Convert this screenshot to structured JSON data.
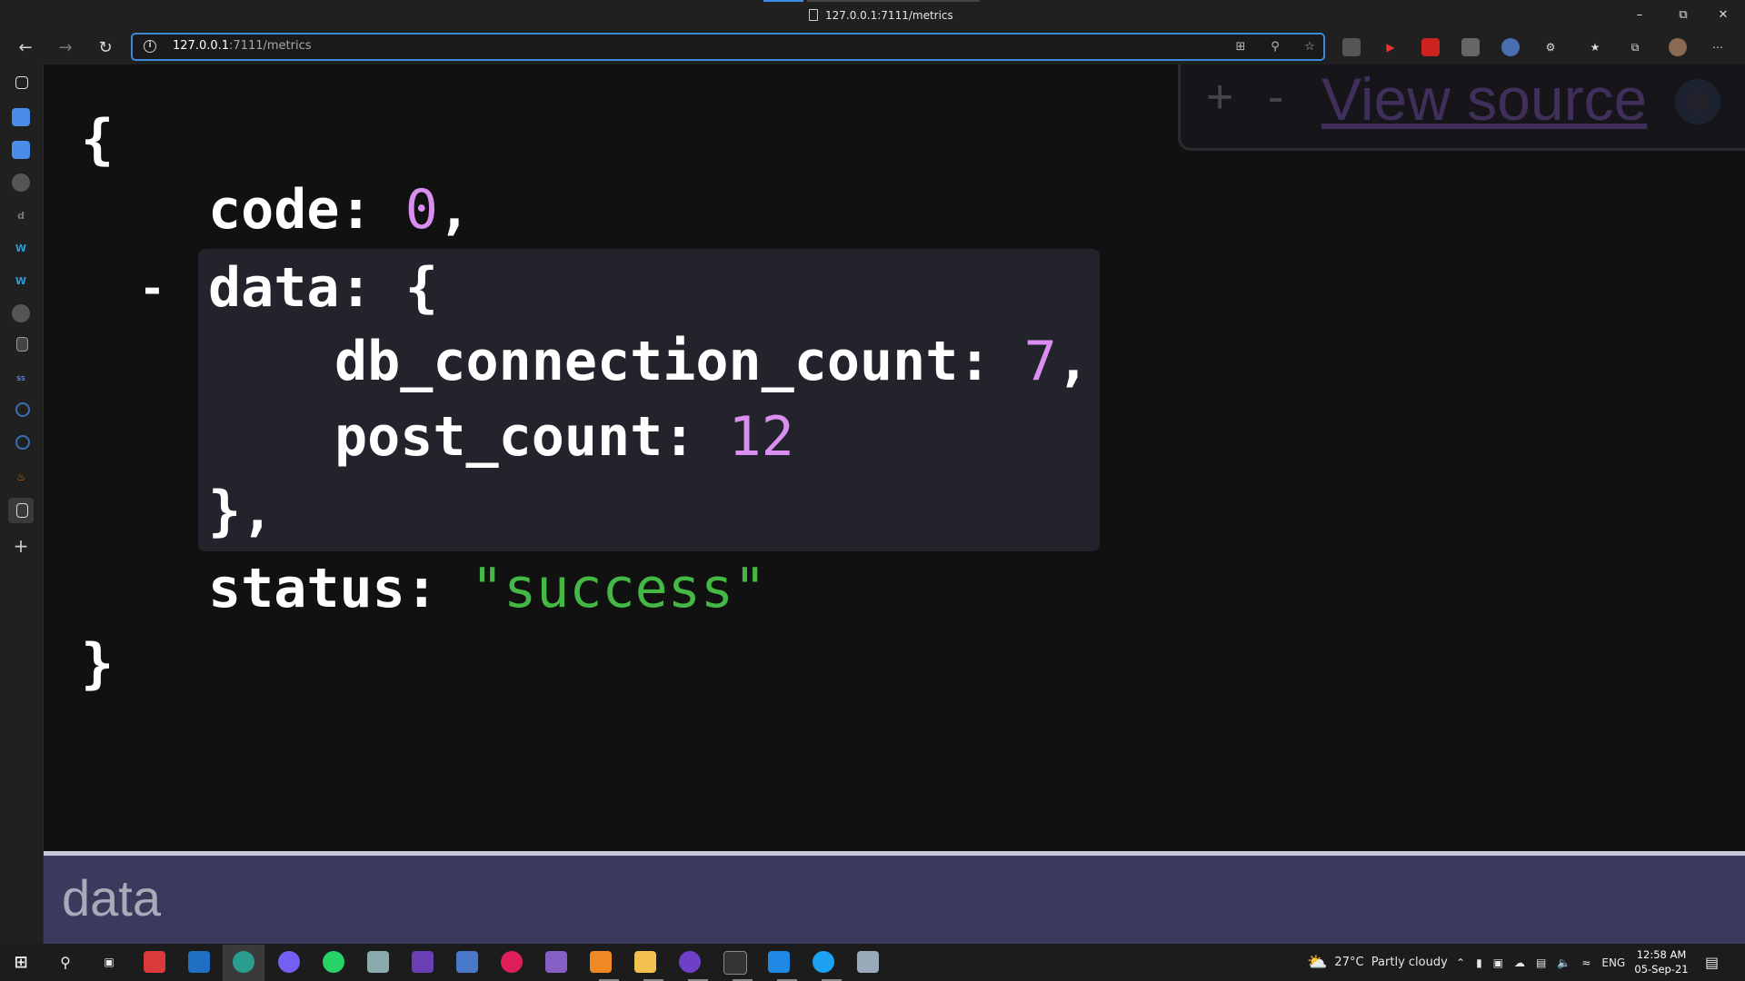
{
  "browser": {
    "tab_title": "127.0.0.1:7111/metrics",
    "url_host": "127.0.0.1",
    "url_rest": ":7111/metrics"
  },
  "json_view": {
    "open_brace": "{",
    "close_brace": "}",
    "code_key": "code:",
    "code_value": "0",
    "data_key": "data:",
    "data_open": "{",
    "db_key": "db_connection_count:",
    "db_value": "7",
    "post_key": "post_count:",
    "post_value": "12",
    "data_close": "},",
    "status_key": "status:",
    "status_value": "\"success\"",
    "comma": ",",
    "collapse_toggle": "-"
  },
  "viewer_panel": {
    "zoom_in": "+",
    "zoom_out": "-",
    "view_source": "View source"
  },
  "status_path": "data",
  "taskbar": {
    "weather": "27°C  Partly cloudy",
    "language": "ENG",
    "time": "12:58 AM",
    "date": "05-Sep-21"
  },
  "colors": {
    "number": "#d98ef0",
    "string": "#44b844",
    "accent": "#3b8ad9"
  }
}
